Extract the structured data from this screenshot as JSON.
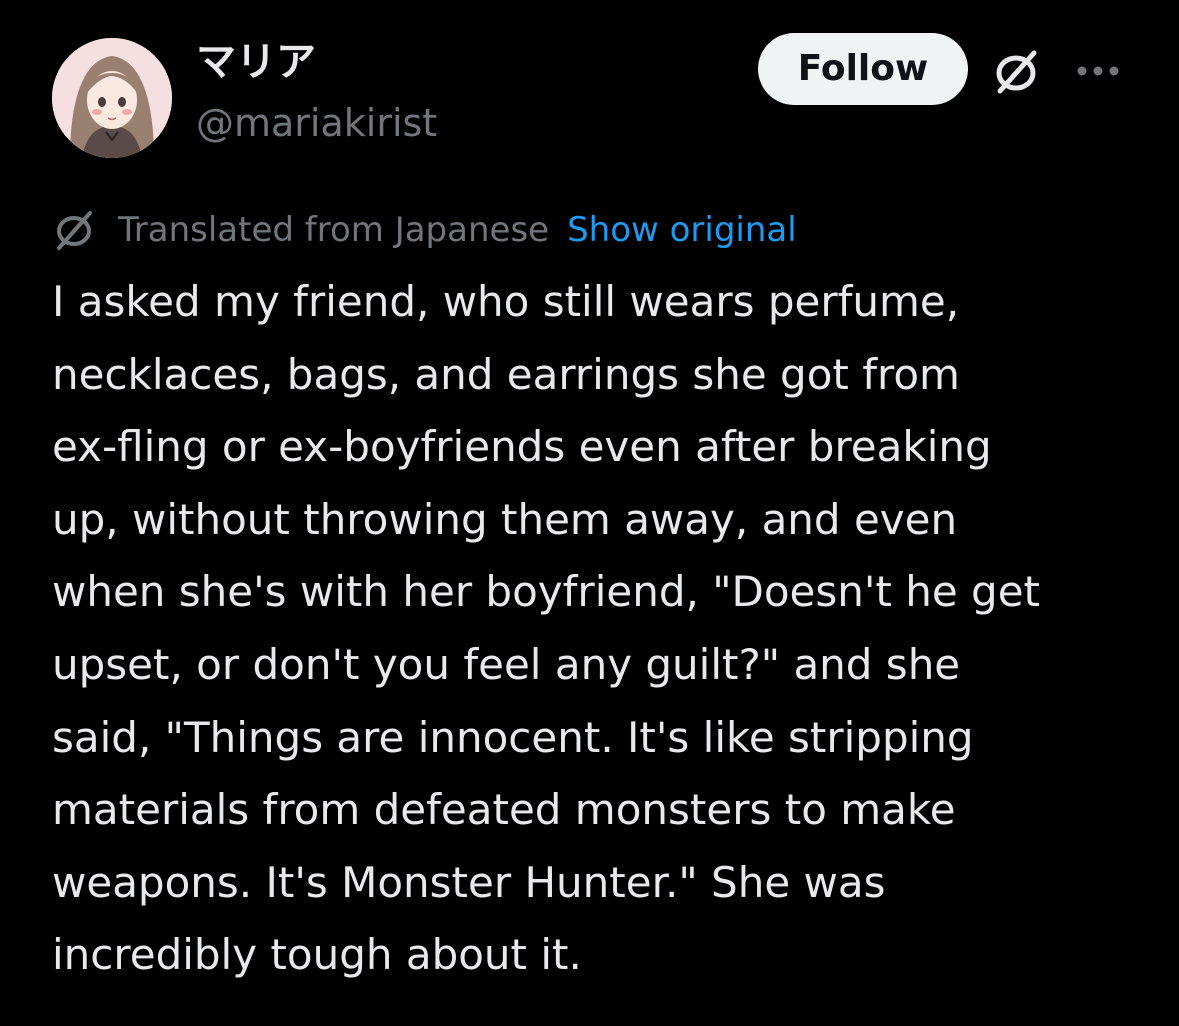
{
  "author": {
    "display_name": "マリア",
    "handle": "@mariakirist"
  },
  "actions": {
    "follow_label": "Follow",
    "translate_icon": "translate-slash-icon",
    "more_icon": "more-dots-icon"
  },
  "translation": {
    "label": "Translated from Japanese",
    "show_original_label": "Show original"
  },
  "post": {
    "lines": [
      "I asked my friend, who still wears perfume,",
      "necklaces, bags, and earrings she got from",
      "ex-fling or ex-boyfriends even after breaking",
      "up, without throwing them away, and even",
      "when she's with her boyfriend, \"Doesn't he get",
      "upset, or don't you feel any guilt?\" and she",
      "said, \"Things are innocent. It's like stripping",
      "materials from defeated monsters to make",
      "weapons. It's Monster Hunter.\" She was",
      "incredibly tough about it."
    ]
  },
  "colors": {
    "background": "#000000",
    "text_primary": "#e7e9ea",
    "text_secondary": "#71767b",
    "link": "#1d9bf0",
    "follow_bg": "#eff3f4"
  }
}
